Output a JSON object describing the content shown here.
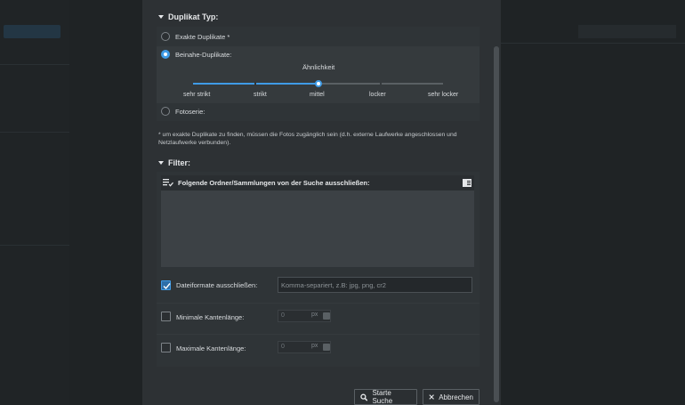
{
  "duplicate_type": {
    "title": "Duplikat Typ:",
    "exact_label": "Exakte Duplikate *",
    "near_label": "Beinahe-Duplikate:",
    "similarity_label": "Ähnlichkeit",
    "similarity_levels": [
      "sehr strikt",
      "strikt",
      "mittel",
      "locker",
      "sehr locker"
    ],
    "similarity_selected": "mittel",
    "series_label": "Fotoserie:",
    "selected": "Beinahe-Duplikate:",
    "footnote": "* um exakte Duplikate zu finden, müssen die Fotos zugänglich sein (d.h. externe Laufwerke angeschlossen und Netzlaufwerke verbunden)."
  },
  "filter": {
    "title": "Filter:",
    "exclude_label": "Folgende Ordner/Sammlungen von der Suche ausschließen:",
    "file_formats": {
      "label": "Dateiformate ausschließen:",
      "checked": true,
      "placeholder": "Komma-separiert, z.B: jpg, png, cr2"
    },
    "min_edge": {
      "label": "Minimale Kantenlänge:",
      "checked": false,
      "value": "0",
      "unit": "px"
    },
    "max_edge": {
      "label": "Maximale Kantenlänge:",
      "checked": false,
      "value": "0",
      "unit": "px"
    }
  },
  "buttons": {
    "start": "Starte Suche",
    "cancel": "Abbrechen"
  },
  "colors": {
    "accent": "#3f9be6",
    "dialog_bg": "#2d3134",
    "panel_bg": "#2f3437"
  }
}
